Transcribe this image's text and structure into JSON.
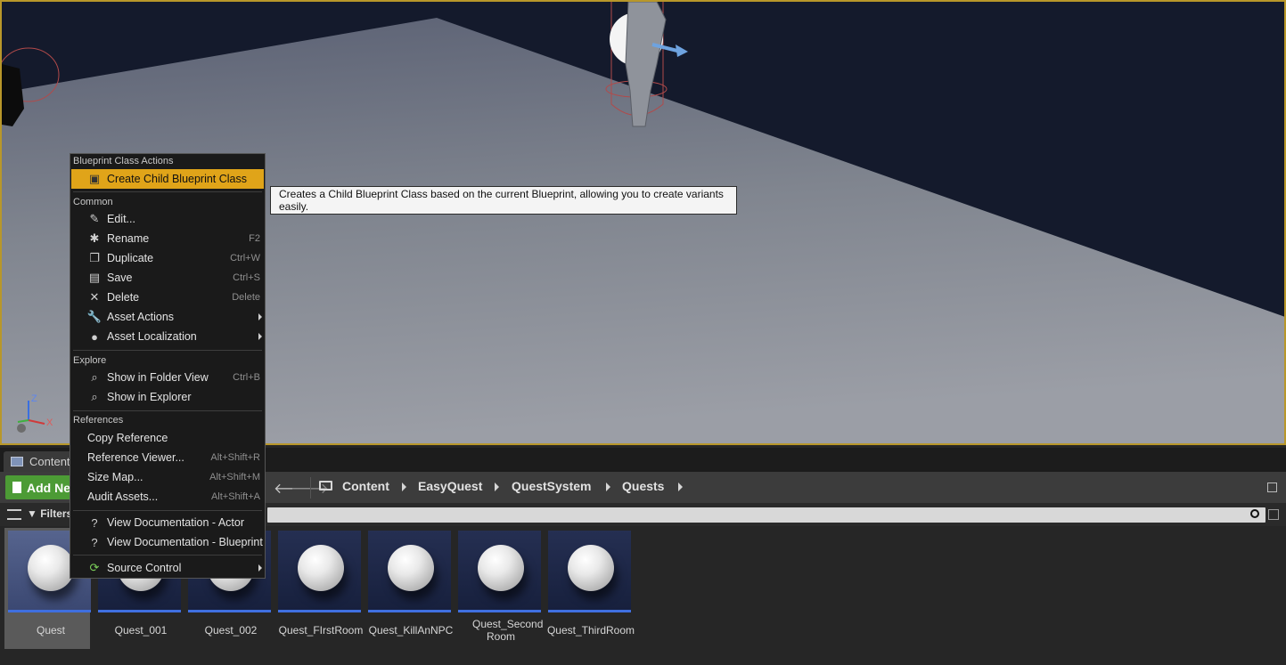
{
  "viewport": {
    "axes": {
      "x": "X",
      "z": "Z"
    }
  },
  "content_browser": {
    "tab_label": "Content",
    "add_new_label": "Add Ne",
    "filters_label": "Filters",
    "breadcrumbs": [
      "Content",
      "EasyQuest",
      "QuestSystem",
      "Quests"
    ],
    "assets": [
      {
        "label": "Quest",
        "selected": true
      },
      {
        "label": "Quest_001"
      },
      {
        "label": "Quest_002"
      },
      {
        "label": "Quest_FIrstRoom"
      },
      {
        "label": "Quest_KillAnNPC"
      },
      {
        "label": "Quest_Second Room"
      },
      {
        "label": "Quest_ThirdRoom"
      }
    ]
  },
  "context_menu": {
    "sections": {
      "blueprint": "Blueprint Class Actions",
      "common": "Common",
      "explore": "Explore",
      "references": "References"
    },
    "items": {
      "create_child": {
        "label": "Create Child Blueprint Class",
        "icon": "blueprint-child-icon",
        "highlighted": true
      },
      "edit": {
        "label": "Edit...",
        "icon": "pencil-icon"
      },
      "rename": {
        "label": "Rename",
        "shortcut": "F2",
        "icon": "rename-icon"
      },
      "duplicate": {
        "label": "Duplicate",
        "shortcut": "Ctrl+W",
        "icon": "duplicate-icon"
      },
      "save": {
        "label": "Save",
        "shortcut": "Ctrl+S",
        "icon": "save-icon"
      },
      "delete": {
        "label": "Delete",
        "shortcut": "Delete",
        "icon": "delete-icon"
      },
      "asset_actions": {
        "label": "Asset Actions",
        "icon": "wrench-icon"
      },
      "asset_localization": {
        "label": "Asset Localization",
        "icon": "globe-icon"
      },
      "show_folder": {
        "label": "Show in Folder View",
        "shortcut": "Ctrl+B",
        "icon": "find-icon"
      },
      "show_explorer": {
        "label": "Show in Explorer",
        "icon": "find-icon"
      },
      "copy_reference": {
        "label": "Copy Reference"
      },
      "reference_viewer": {
        "label": "Reference Viewer...",
        "shortcut": "Alt+Shift+R"
      },
      "size_map": {
        "label": "Size Map...",
        "shortcut": "Alt+Shift+M"
      },
      "audit_assets": {
        "label": "Audit Assets...",
        "shortcut": "Alt+Shift+A"
      },
      "doc_actor": {
        "label": "View Documentation - Actor",
        "icon": "help-icon"
      },
      "doc_blueprint": {
        "label": "View Documentation - Blueprint",
        "icon": "help-icon"
      },
      "source_control": {
        "label": "Source Control",
        "icon": "source-control-icon"
      }
    }
  },
  "tooltip": {
    "text": "Creates a Child Blueprint Class based on the current Blueprint, allowing you to create variants easily."
  },
  "colors": {
    "highlight": "#e0a419",
    "add_new": "#4c9b35",
    "asset_underline": "#3f6fe0",
    "viewport_border": "#b8972a"
  }
}
